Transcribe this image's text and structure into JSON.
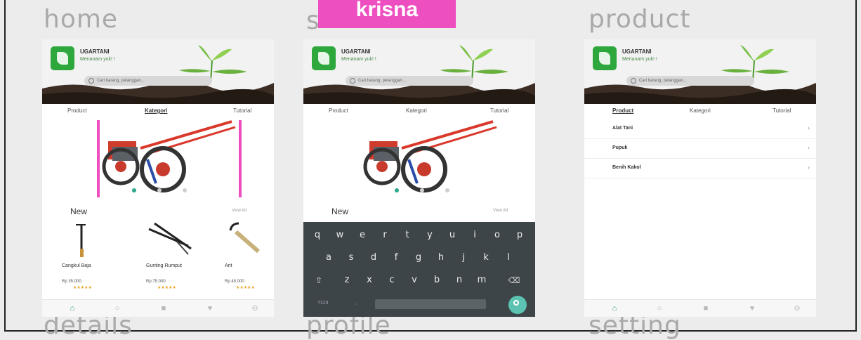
{
  "colors": {
    "highlight": "#ee4fc0",
    "accent": "#2aa78d",
    "brand_green": "#2ea83c",
    "star": "#e8a01b"
  },
  "labels": {
    "top": [
      "home",
      "s",
      "product"
    ],
    "bottom": [
      "details",
      "profile",
      "setting"
    ]
  },
  "highlight_tag": "krisna",
  "app": {
    "brand_name": "UGARTANI",
    "brand_tagline": "Menanam yuk! !",
    "search_placeholder": "Cari barang, pelanggan..."
  },
  "screens": [
    {
      "tabs": [
        "Product",
        "Kategori",
        "Tutorial"
      ],
      "active_tab": "Kategori",
      "section_title": "New",
      "view_all": "View All",
      "products": [
        {
          "name": "Cangkul Baja",
          "price": "Rp 35.000",
          "stars": "★★★★★",
          "icon": "hoe-icon"
        },
        {
          "name": "Gunting Rumput",
          "price": "Rp 75.000",
          "stars": "★★★★★",
          "icon": "shears-icon"
        },
        {
          "name": "Arit",
          "price": "Rp 45.000",
          "stars": "★★★★★",
          "icon": "sickle-icon"
        }
      ]
    },
    {
      "tabs": [
        "Product",
        "Kategori",
        "Tutorial"
      ],
      "section_title": "New",
      "view_all": "View All",
      "keyboard_rows": [
        [
          "q",
          "w",
          "e",
          "r",
          "t",
          "y",
          "u",
          "i",
          "o",
          "p"
        ],
        [
          "a",
          "s",
          "d",
          "f",
          "g",
          "h",
          "j",
          "k",
          "l"
        ],
        [
          "z",
          "x",
          "c",
          "v",
          "b",
          "n",
          "m"
        ]
      ],
      "keyboard_small": [
        "?123",
        ","
      ]
    },
    {
      "tabs": [
        "Product",
        "Kategori",
        "Tutorial"
      ],
      "active_tab": "Product",
      "categories": [
        "Alat Tani",
        "Pupuk",
        "Benih Kakol"
      ]
    }
  ],
  "nav_icons": [
    "home-icon",
    "search-icon",
    "bag-icon",
    "heart-icon",
    "profile-icon"
  ]
}
